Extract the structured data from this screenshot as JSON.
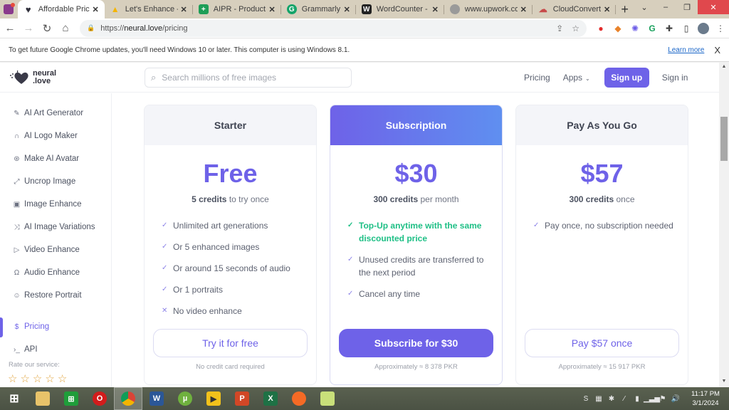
{
  "browser": {
    "tabs": [
      {
        "label": "Affordable Pricing",
        "active": true,
        "icon": "neural-love-heart-icon",
        "color": "#2f2f3a"
      },
      {
        "label": "Let's Enhance - G",
        "active": false,
        "icon": "google-drive-icon",
        "color": "#f4b400"
      },
      {
        "label": "AIPR - Product R",
        "active": false,
        "icon": "google-sheets-icon",
        "color": "#1e9e57"
      },
      {
        "label": "Grammarly",
        "active": false,
        "icon": "grammarly-icon",
        "color": "#15a46a"
      },
      {
        "label": "WordCounter - C",
        "active": false,
        "icon": "wordcounter-icon",
        "color": "#222222"
      },
      {
        "label": "www.upwork.com",
        "active": false,
        "icon": "globe-icon",
        "color": "#9a9a9a"
      },
      {
        "label": "CloudConvert",
        "active": false,
        "icon": "cloudconvert-icon",
        "color": "#c74a4a"
      }
    ],
    "new_tab": "+",
    "url": {
      "prefix": "https://",
      "domain": "neural.love",
      "path": "/pricing"
    },
    "window_controls": {
      "dropdown": "⌄",
      "minimize": "–",
      "restore": "❐",
      "close": "✕"
    }
  },
  "infobar": {
    "message": "To get future Google Chrome updates, you'll need Windows 10 or later. This computer is using Windows 8.1.",
    "link": "Learn more",
    "close": "X"
  },
  "site": {
    "logo_line1": "neural",
    "logo_line2": ".love",
    "search_placeholder": "Search millions of free images",
    "nav": {
      "pricing": "Pricing",
      "apps": "Apps",
      "signup": "Sign up",
      "signin": "Sign in"
    },
    "accent": "#6e62e8"
  },
  "sidebar": {
    "items": [
      {
        "label": "AI Art Generator",
        "icon": "brush-icon"
      },
      {
        "label": "AI Logo Maker",
        "icon": "arch-icon"
      },
      {
        "label": "Make AI Avatar",
        "icon": "aperture-icon"
      },
      {
        "label": "Uncrop Image",
        "icon": "expand-icon"
      },
      {
        "label": "Image Enhance",
        "icon": "image-icon"
      },
      {
        "label": "AI Image Variations",
        "icon": "shuffle-icon"
      },
      {
        "label": "Video Enhance",
        "icon": "play-icon"
      },
      {
        "label": "Audio Enhance",
        "icon": "headphones-icon"
      },
      {
        "label": "Restore Portrait",
        "icon": "smile-icon"
      },
      {
        "label": "Pricing",
        "icon": "dollar-icon",
        "active": true
      },
      {
        "label": "API",
        "icon": "terminal-icon"
      }
    ],
    "rate_label": "Rate our service:",
    "rating": {
      "value": 0,
      "max": 5
    }
  },
  "plans": [
    {
      "name": "Starter",
      "price": "Free",
      "credits_bold": "5 credits",
      "credits_rest": " to try once",
      "features": [
        {
          "text": "Unlimited art generations",
          "type": "check"
        },
        {
          "text": "Or 5 enhanced images",
          "type": "check"
        },
        {
          "text": "Or around 15 seconds of audio",
          "type": "check"
        },
        {
          "text": "Or 1 portraits",
          "type": "check"
        },
        {
          "text": "No video enhance",
          "type": "cross"
        }
      ],
      "cta": "Try it for free",
      "note": "No credit card required"
    },
    {
      "name": "Subscription",
      "price": "$30",
      "credits_bold": "300 credits",
      "credits_rest": " per month",
      "features": [
        {
          "text": "Top-Up anytime with the same discounted price",
          "type": "highlight"
        },
        {
          "text": "Unused credits are transferred to the next period",
          "type": "check"
        },
        {
          "text": "Cancel any time",
          "type": "check"
        }
      ],
      "cta": "Subscribe for $30",
      "note": "Approximately ≈ 8 378 PKR"
    },
    {
      "name": "Pay As You Go",
      "price": "$57",
      "credits_bold": "300 credits",
      "credits_rest": " once",
      "features": [
        {
          "text": "Pay once, no subscription needed",
          "type": "check"
        }
      ],
      "cta": "Pay $57 once",
      "note": "Approximately ≈ 15 917 PKR"
    }
  ],
  "taskbar": {
    "apps": [
      "windows-start",
      "file-explorer",
      "windows-store",
      "opera",
      "chrome",
      "word",
      "utorrent",
      "player",
      "powerpoint",
      "excel",
      "firefox",
      "sticky-notes"
    ],
    "time": "11:17 PM",
    "date": "3/1/2024"
  }
}
